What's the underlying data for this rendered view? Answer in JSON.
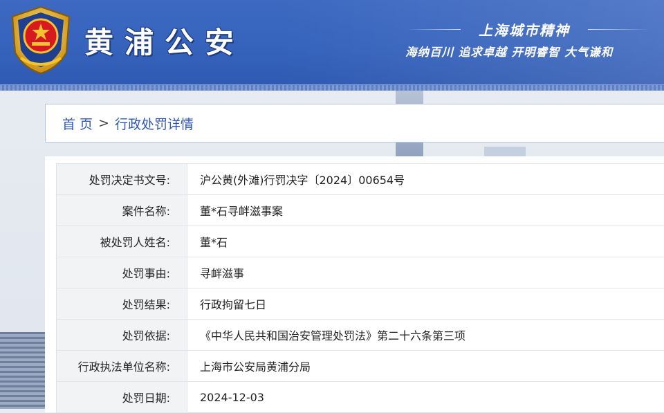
{
  "header": {
    "site_title": "黄浦公安",
    "slogan_main": "上海城市精神",
    "slogan_sub": "海纳百川 追求卓越 开明睿智 大气谦和",
    "colors": {
      "banner": "#3562bb",
      "title": "#ffffff"
    }
  },
  "breadcrumb": {
    "home": "首 页",
    "separator": ">",
    "current": "行政处罚详情",
    "color": "#2f57b0"
  },
  "record": {
    "rows": [
      {
        "label": "处罚决定书文号:",
        "value": "沪公黄(外滩)行罚决字〔2024〕00654号"
      },
      {
        "label": "案件名称:",
        "value": "董*石寻衅滋事案"
      },
      {
        "label": "被处罚人姓名:",
        "value": "董*石"
      },
      {
        "label": "处罚事由:",
        "value": "寻衅滋事"
      },
      {
        "label": "处罚结果:",
        "value": "行政拘留七日"
      },
      {
        "label": "处罚依据:",
        "value": "《中华人民共和国治安管理处罚法》第二十六条第三项"
      },
      {
        "label": "行政执法单位名称:",
        "value": "上海市公安局黄浦分局"
      },
      {
        "label": "处罚日期:",
        "value": "2024-12-03"
      }
    ]
  },
  "icons": {
    "emblem": "police-emblem"
  }
}
